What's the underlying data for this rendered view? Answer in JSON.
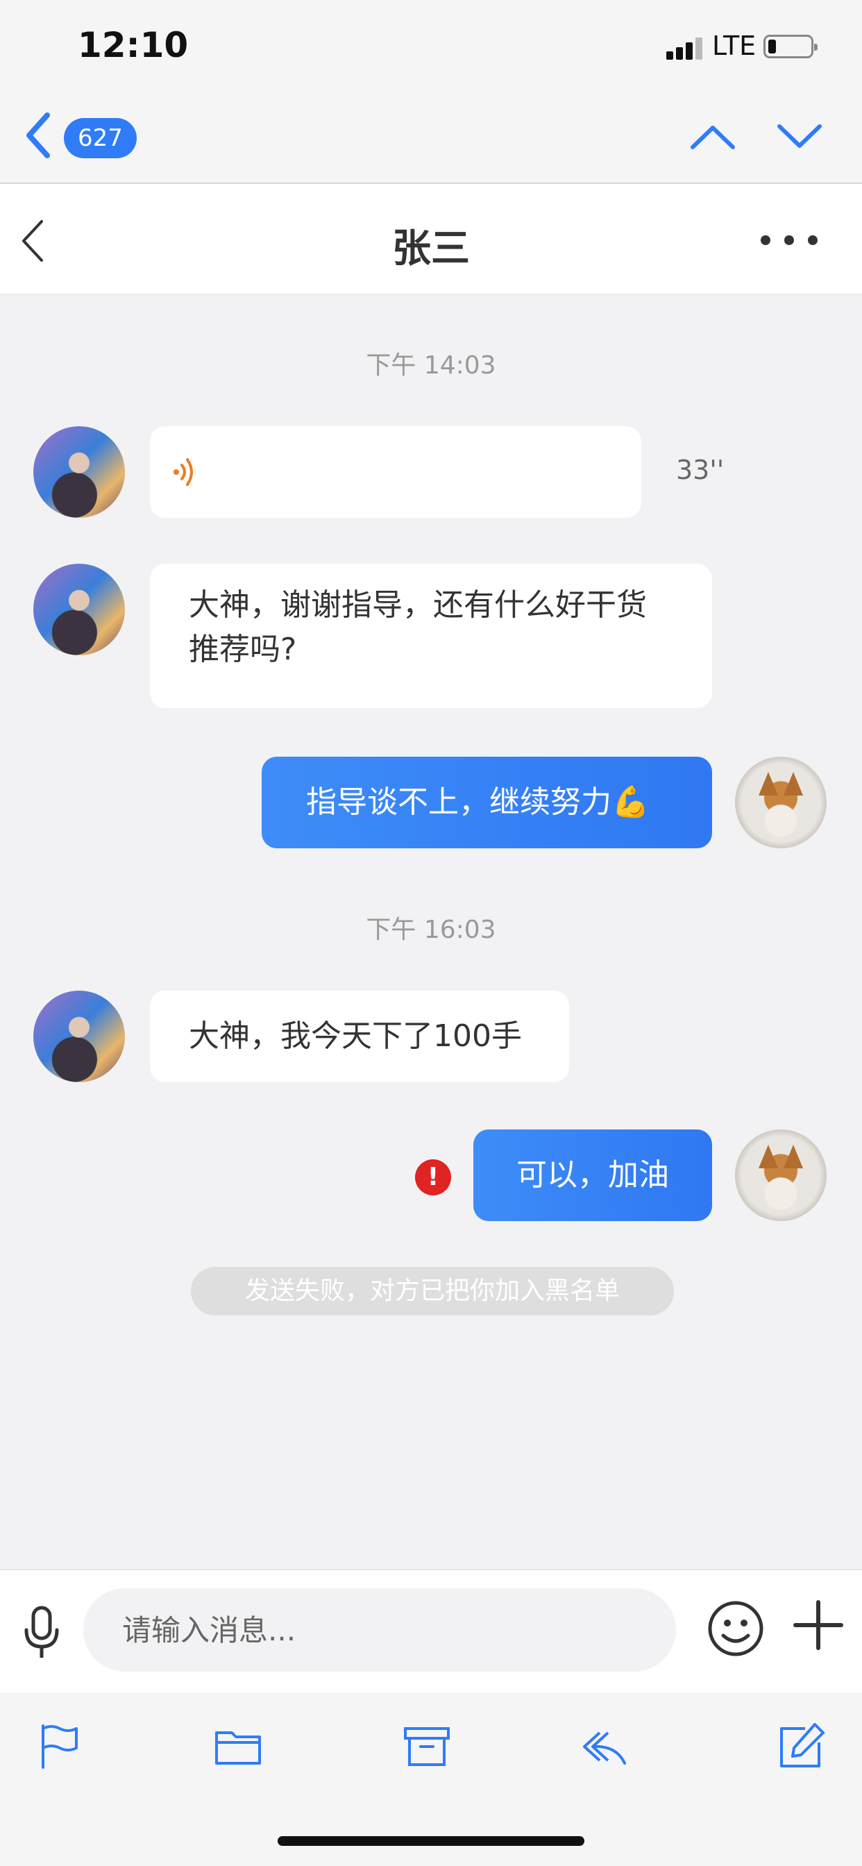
{
  "status_bar": {
    "time": "12:10",
    "network": "LTE"
  },
  "mail_nav": {
    "unread_count": "627",
    "accent_color": "#2f7cf6"
  },
  "chat": {
    "contact_name": "张三",
    "messages": [
      {
        "type": "timestamp",
        "text": "下午 14:03"
      },
      {
        "type": "voice",
        "direction": "in",
        "duration": "33''"
      },
      {
        "type": "text",
        "direction": "in",
        "lines": [
          "大神，谢谢指导，还有什么好干货",
          "推荐吗?"
        ]
      },
      {
        "type": "text",
        "direction": "out",
        "text": "指导谈不上，继续努力💪"
      },
      {
        "type": "timestamp",
        "text": "下午 16:03"
      },
      {
        "type": "text",
        "direction": "in",
        "text": "大神，我今天下了100手"
      },
      {
        "type": "text",
        "direction": "out",
        "text": "可以，加油",
        "status": "failed"
      },
      {
        "type": "notice",
        "text": "发送失败，对方已把你加入黑名单"
      }
    ],
    "error_badge": "!"
  },
  "input_bar": {
    "placeholder": "请输入消息..."
  },
  "toolbar": {
    "icons": [
      "flag-icon",
      "folder-icon",
      "archive-icon",
      "reply-icon",
      "compose-icon"
    ]
  }
}
